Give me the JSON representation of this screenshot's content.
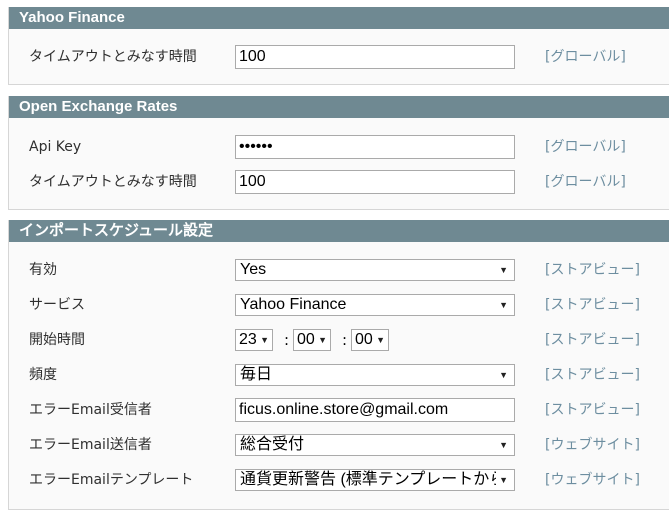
{
  "sections": [
    {
      "title": "Yahoo Finance",
      "rows": [
        {
          "label": "タイムアウトとみなす時間",
          "value": "100",
          "scope": "[グローバル]"
        }
      ]
    },
    {
      "title": "Open Exchange Rates",
      "rows": [
        {
          "label": "Api Key",
          "value": "••••••",
          "scope": "[グローバル]"
        },
        {
          "label": "タイムアウトとみなす時間",
          "value": "100",
          "scope": "[グローバル]"
        }
      ]
    },
    {
      "title": "インポートスケジュール設定",
      "rows": [
        {
          "label": "有効",
          "value": "Yes",
          "scope": "[ストアビュー]"
        },
        {
          "label": "サービス",
          "value": "Yahoo Finance",
          "scope": "[ストアビュー]"
        },
        {
          "label": "開始時間",
          "hour": "23",
          "minute": "00",
          "second": "00",
          "scope": "[ストアビュー]"
        },
        {
          "label": "頻度",
          "value": "毎日",
          "scope": "[ストアビュー]"
        },
        {
          "label": "エラーEmail受信者",
          "value": "ficus.online.store@gmail.com",
          "scope": "[ストアビュー]"
        },
        {
          "label": "エラーEmail送信者",
          "value": "総合受付",
          "scope": "[ウェブサイト]"
        },
        {
          "label": "エラーEmailテンプレート",
          "value": "通貨更新警告 (標準テンプレートから(",
          "scope": "[ウェブサイト]"
        }
      ]
    }
  ],
  "time_separator": ":",
  "icons": {
    "dropdown": "chevron-down-icon"
  }
}
